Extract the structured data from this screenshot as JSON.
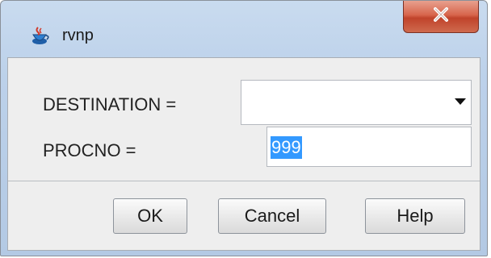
{
  "window": {
    "title": "rvnp",
    "app_icon": "java-cup-icon",
    "close_icon": "close-x-icon"
  },
  "form": {
    "destination_label": "DESTINATION =",
    "destination_value": "",
    "procno_label": "PROCNO =",
    "procno_value": "999"
  },
  "buttons": {
    "ok": "OK",
    "cancel": "Cancel",
    "help": "Help"
  },
  "colors": {
    "selection": "#3399ff",
    "close_button": "#c0432b",
    "titlebar": "#bcd1ea"
  }
}
